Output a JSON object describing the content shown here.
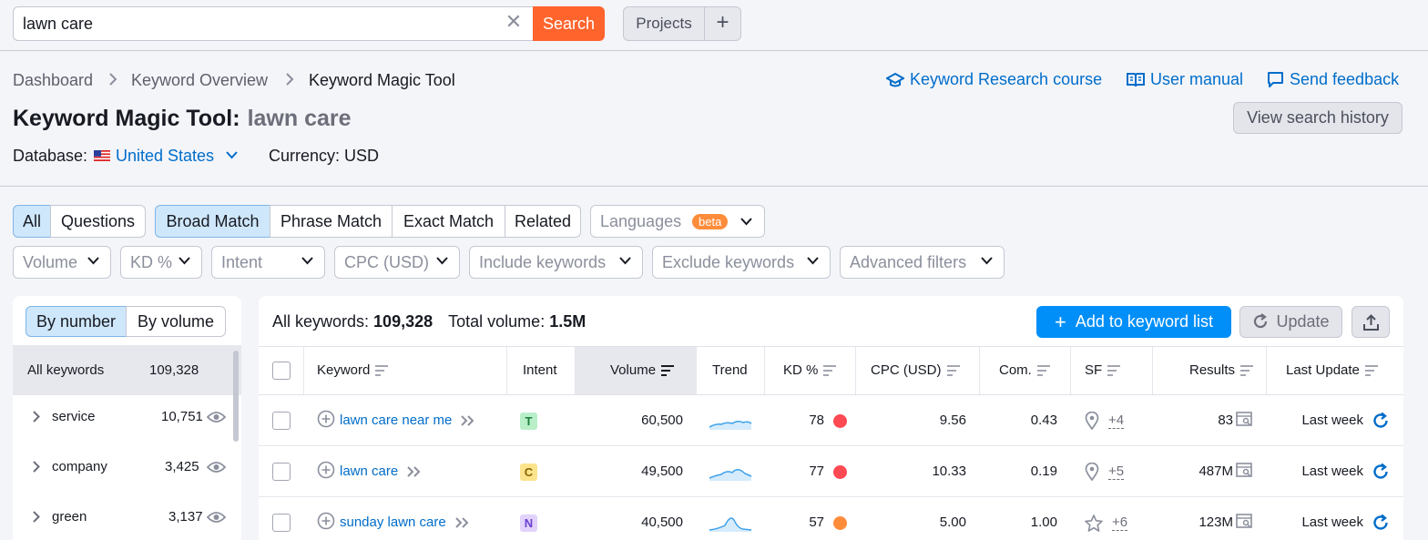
{
  "search": {
    "value": "lawn care",
    "button": "Search"
  },
  "projects": {
    "label": "Projects",
    "plus": "+"
  },
  "breadcrumb": [
    "Dashboard",
    "Keyword Overview",
    "Keyword Magic Tool"
  ],
  "toplinks": {
    "course": "Keyword Research course",
    "manual": "User manual",
    "feedback": "Send feedback"
  },
  "title": {
    "tool": "Keyword Magic Tool:",
    "query": "lawn care"
  },
  "history_button": "View search history",
  "database": {
    "label": "Database:",
    "value": "United States",
    "currency": "Currency: USD"
  },
  "tabs": {
    "all": "All",
    "questions": "Questions"
  },
  "match": [
    "Broad Match",
    "Phrase Match",
    "Exact Match",
    "Related"
  ],
  "languages": {
    "label": "Languages",
    "badge": "beta"
  },
  "filters": [
    "Volume",
    "KD %",
    "Intent",
    "CPC (USD)",
    "Include keywords",
    "Exclude keywords",
    "Advanced filters"
  ],
  "left": {
    "by_number": "By number",
    "by_volume": "By volume",
    "all_label": "All keywords",
    "all_count": "109,328",
    "groups": [
      {
        "name": "service",
        "count": "10,751"
      },
      {
        "name": "company",
        "count": "3,425"
      },
      {
        "name": "green",
        "count": "3,137"
      }
    ]
  },
  "summary": {
    "all_label": "All keywords:",
    "all_value": "109,328",
    "vol_label": "Total volume:",
    "vol_value": "1.5M"
  },
  "actions": {
    "add": "Add to keyword list",
    "update": "Update"
  },
  "columns": [
    "Keyword",
    "Intent",
    "Volume",
    "Trend",
    "KD %",
    "CPC (USD)",
    "Com.",
    "SF",
    "Results",
    "Last Update"
  ],
  "rows": [
    {
      "keyword": "lawn care near me",
      "intent": "T",
      "intent_bg": "#b9efc8",
      "intent_fg": "#1a7e3c",
      "volume": "60,500",
      "kd": "78",
      "kd_color": "#ff4953",
      "cpc": "9.56",
      "com": "0.43",
      "sf_icon": "location-pin-icon",
      "sf_more": "+4",
      "results": "83",
      "last_update": "Last week"
    },
    {
      "keyword": "lawn care",
      "intent": "C",
      "intent_bg": "#fbe48c",
      "intent_fg": "#8a6400",
      "volume": "49,500",
      "kd": "77",
      "kd_color": "#ff4953",
      "cpc": "10.33",
      "com": "0.19",
      "sf_icon": "location-pin-icon",
      "sf_more": "+5",
      "results": "487M",
      "last_update": "Last week"
    },
    {
      "keyword": "sunday lawn care",
      "intent": "N",
      "intent_bg": "#e1d3fb",
      "intent_fg": "#6b3fcf",
      "volume": "40,500",
      "kd": "57",
      "kd_color": "#ff8c3b",
      "cpc": "5.00",
      "com": "1.00",
      "sf_icon": "star-icon",
      "sf_more": "+6",
      "results": "123M",
      "last_update": "Last week"
    }
  ],
  "colors": {
    "accent": "#ff642d",
    "primary": "#008ff8",
    "link": "#006dca"
  }
}
